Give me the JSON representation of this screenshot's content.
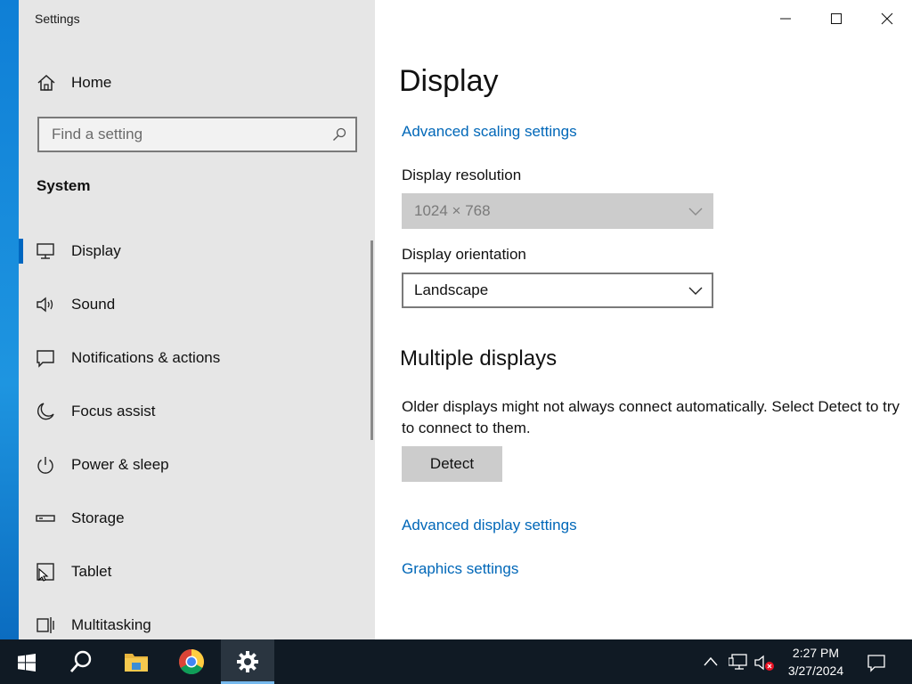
{
  "window": {
    "app_title": "Settings"
  },
  "sidebar": {
    "home_label": "Home",
    "search_placeholder": "Find a setting",
    "section_title": "System",
    "items": [
      {
        "label": "Display",
        "icon": "monitor-icon",
        "active": true
      },
      {
        "label": "Sound",
        "icon": "speaker-icon"
      },
      {
        "label": "Notifications & actions",
        "icon": "notification-icon"
      },
      {
        "label": "Focus assist",
        "icon": "moon-icon"
      },
      {
        "label": "Power & sleep",
        "icon": "power-icon"
      },
      {
        "label": "Storage",
        "icon": "storage-icon"
      },
      {
        "label": "Tablet",
        "icon": "tablet-icon"
      },
      {
        "label": "Multitasking",
        "icon": "multitasking-icon"
      }
    ]
  },
  "main": {
    "title": "Display",
    "advanced_scaling_link": "Advanced scaling settings",
    "resolution_label": "Display resolution",
    "resolution_value": "1024 × 768",
    "orientation_label": "Display orientation",
    "orientation_value": "Landscape",
    "multiple_displays_heading": "Multiple displays",
    "multiple_displays_desc": "Older displays might not always connect automatically. Select Detect to try to connect to them.",
    "detect_label": "Detect",
    "advanced_display_link": "Advanced display settings",
    "graphics_link": "Graphics settings"
  },
  "taskbar": {
    "apps": [
      "start",
      "search",
      "file-explorer",
      "chrome",
      "settings"
    ],
    "clock_time": "2:27 PM",
    "clock_date": "3/27/2024"
  },
  "colors": {
    "accent": "#0067c0",
    "link": "#0067b8",
    "sidebar_bg": "#e6e6e6",
    "taskbar_bg": "#101a24"
  }
}
